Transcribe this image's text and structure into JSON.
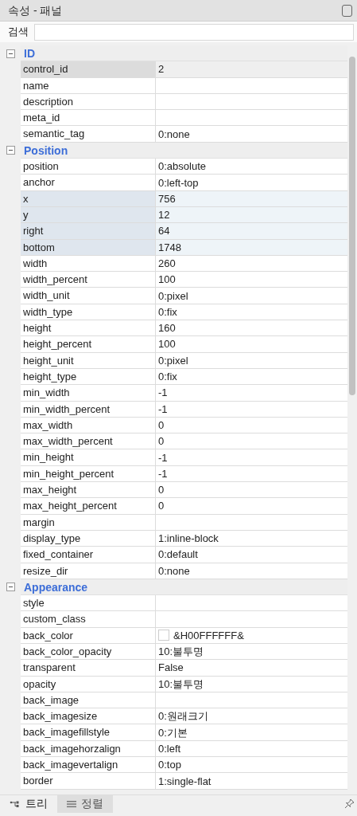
{
  "panel": {
    "title": "속성 - 패널"
  },
  "search": {
    "label": "검색"
  },
  "groups": [
    {
      "name": "ID",
      "expanded": true,
      "rows": [
        {
          "name": "control_id",
          "value": "2",
          "selected": true,
          "highlighted": false
        },
        {
          "name": "name",
          "value": "",
          "selected": false,
          "highlighted": false
        },
        {
          "name": "description",
          "value": "",
          "selected": false,
          "highlighted": false
        },
        {
          "name": "meta_id",
          "value": "",
          "selected": false,
          "highlighted": false
        },
        {
          "name": "semantic_tag",
          "value": "0:none",
          "selected": false,
          "highlighted": false
        }
      ]
    },
    {
      "name": "Position",
      "expanded": true,
      "rows": [
        {
          "name": "position",
          "value": "0:absolute",
          "selected": false,
          "highlighted": false
        },
        {
          "name": "anchor",
          "value": "0:left-top",
          "selected": false,
          "highlighted": false
        },
        {
          "name": "x",
          "value": "756",
          "selected": false,
          "highlighted": true
        },
        {
          "name": "y",
          "value": "12",
          "selected": false,
          "highlighted": true
        },
        {
          "name": "right",
          "value": "64",
          "selected": false,
          "highlighted": true
        },
        {
          "name": "bottom",
          "value": "1748",
          "selected": false,
          "highlighted": true
        },
        {
          "name": "width",
          "value": "260",
          "selected": false,
          "highlighted": false
        },
        {
          "name": "width_percent",
          "value": "100",
          "selected": false,
          "highlighted": false
        },
        {
          "name": "width_unit",
          "value": "0:pixel",
          "selected": false,
          "highlighted": false
        },
        {
          "name": "width_type",
          "value": "0:fix",
          "selected": false,
          "highlighted": false
        },
        {
          "name": "height",
          "value": "160",
          "selected": false,
          "highlighted": false
        },
        {
          "name": "height_percent",
          "value": "100",
          "selected": false,
          "highlighted": false
        },
        {
          "name": "height_unit",
          "value": "0:pixel",
          "selected": false,
          "highlighted": false
        },
        {
          "name": "height_type",
          "value": "0:fix",
          "selected": false,
          "highlighted": false
        },
        {
          "name": "min_width",
          "value": "-1",
          "selected": false,
          "highlighted": false
        },
        {
          "name": "min_width_percent",
          "value": "-1",
          "selected": false,
          "highlighted": false
        },
        {
          "name": "max_width",
          "value": "0",
          "selected": false,
          "highlighted": false
        },
        {
          "name": "max_width_percent",
          "value": "0",
          "selected": false,
          "highlighted": false
        },
        {
          "name": "min_height",
          "value": "-1",
          "selected": false,
          "highlighted": false
        },
        {
          "name": "min_height_percent",
          "value": "-1",
          "selected": false,
          "highlighted": false
        },
        {
          "name": "max_height",
          "value": "0",
          "selected": false,
          "highlighted": false
        },
        {
          "name": "max_height_percent",
          "value": "0",
          "selected": false,
          "highlighted": false
        },
        {
          "name": "margin",
          "value": "",
          "selected": false,
          "highlighted": false
        },
        {
          "name": "display_type",
          "value": "1:inline-block",
          "selected": false,
          "highlighted": false
        },
        {
          "name": "fixed_container",
          "value": "0:default",
          "selected": false,
          "highlighted": false
        },
        {
          "name": "resize_dir",
          "value": "0:none",
          "selected": false,
          "highlighted": false
        }
      ]
    },
    {
      "name": "Appearance",
      "expanded": true,
      "rows": [
        {
          "name": "style",
          "value": "",
          "selected": false,
          "highlighted": false
        },
        {
          "name": "custom_class",
          "value": "",
          "selected": false,
          "highlighted": false
        },
        {
          "name": "back_color",
          "value": "&H00FFFFFF&",
          "color": "#ffffff",
          "selected": false,
          "highlighted": false
        },
        {
          "name": "back_color_opacity",
          "value": "10:불투명",
          "selected": false,
          "highlighted": false
        },
        {
          "name": "transparent",
          "value": "False",
          "selected": false,
          "highlighted": false
        },
        {
          "name": "opacity",
          "value": "10:불투명",
          "selected": false,
          "highlighted": false
        },
        {
          "name": "back_image",
          "value": "",
          "selected": false,
          "highlighted": false
        },
        {
          "name": "back_imagesize",
          "value": "0:원래크기",
          "selected": false,
          "highlighted": false
        },
        {
          "name": "back_imagefillstyle",
          "value": "0:기본",
          "selected": false,
          "highlighted": false
        },
        {
          "name": "back_imagehorzalign",
          "value": "0:left",
          "selected": false,
          "highlighted": false
        },
        {
          "name": "back_imagevertalign",
          "value": "0:top",
          "selected": false,
          "highlighted": false
        },
        {
          "name": "border",
          "value": "1:single-flat",
          "selected": false,
          "highlighted": false
        }
      ]
    }
  ],
  "tabs": [
    {
      "label": "트리",
      "kind": "tree",
      "selected": true
    },
    {
      "label": "정렬",
      "kind": "list",
      "selected": false
    }
  ]
}
